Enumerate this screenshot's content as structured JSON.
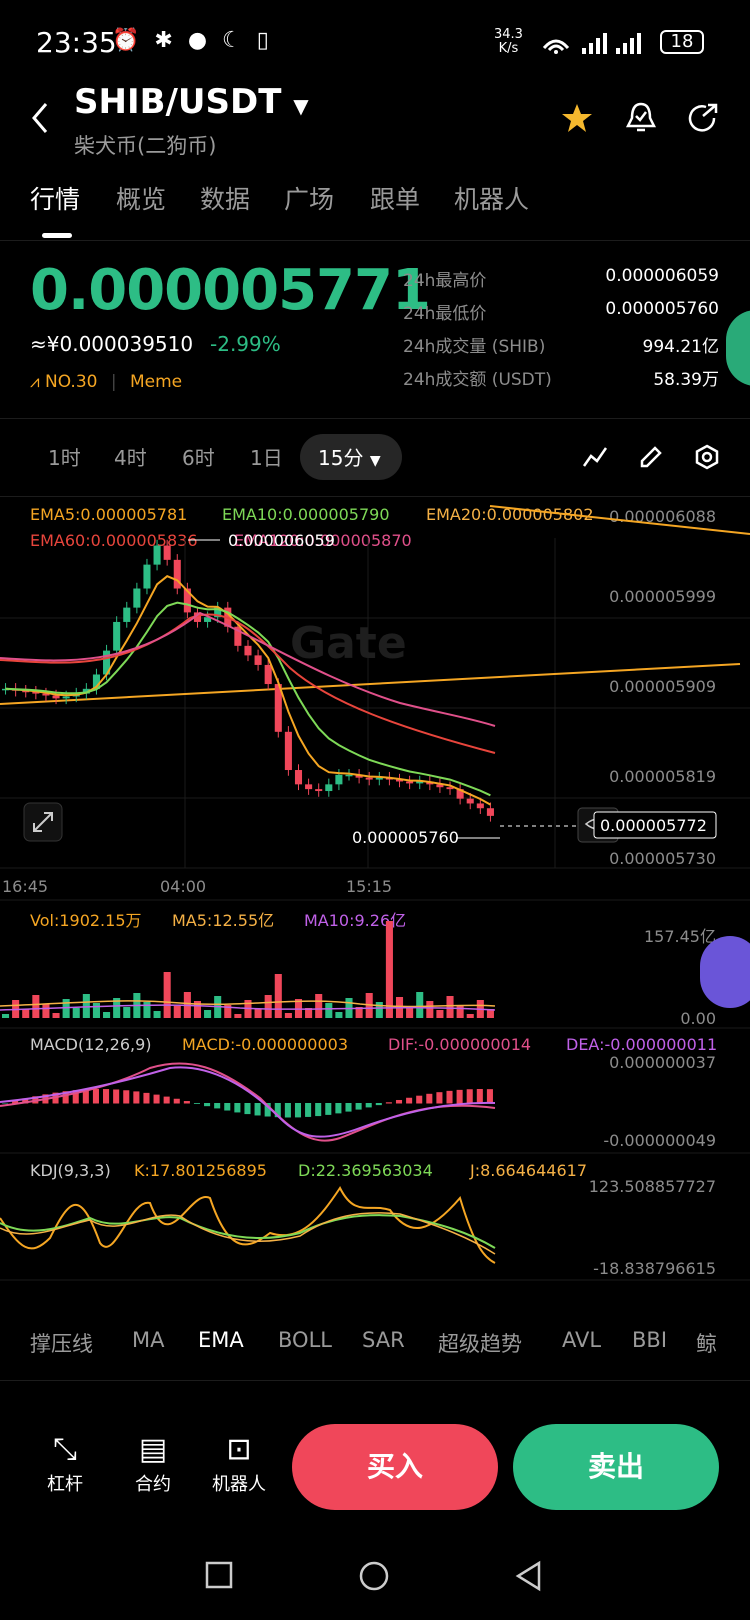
{
  "status_bar": {
    "time": "23:35",
    "net_speed_value": "34.3",
    "net_speed_unit": "K/s",
    "battery": "18"
  },
  "header": {
    "pair": "SHIB/USDT",
    "subtitle": "柴犬币(二狗币)"
  },
  "tabs": [
    "行情",
    "概览",
    "数据",
    "广场",
    "跟单",
    "机器人"
  ],
  "ticker": {
    "price": "0.000005771",
    "cny_price": "≈¥0.000039510",
    "change": "-2.99%",
    "rank": "NO.30",
    "tag": "Meme",
    "stats": [
      {
        "label": "24h最高价",
        "value": "0.000006059"
      },
      {
        "label": "24h最低价",
        "value": "0.000005760"
      },
      {
        "label": "24h成交量 (SHIB)",
        "value": "994.21亿"
      },
      {
        "label": "24h成交额 (USDT)",
        "value": "58.39万"
      }
    ]
  },
  "intervals": [
    "1时",
    "4时",
    "6时",
    "1日",
    "15分"
  ],
  "ema_legend": {
    "ema5": "EMA5:0.000005781",
    "ema10": "EMA10:0.000005790",
    "ema20": "EMA20:0.000005802",
    "ema60": "EMA60:0.000005836",
    "ema120": "EMA120:0.000005870"
  },
  "chart_data": [
    {
      "type": "candlestick",
      "price_axis": [
        "0.000006088",
        "0.000005999",
        "0.000005909",
        "0.000005819",
        "0.000005730"
      ],
      "time_axis": [
        "16:45",
        "04:00",
        "15:15"
      ],
      "high_marker": "0.000006059",
      "low_marker": "0.000005760",
      "current_price": "0.000005772",
      "close_series": [
        5.905,
        5.903,
        5.902,
        5.9,
        5.898,
        5.895,
        5.897,
        5.9,
        5.905,
        5.92,
        5.945,
        5.975,
        5.99,
        6.01,
        6.035,
        6.055,
        6.04,
        6.01,
        5.985,
        5.975,
        5.98,
        5.99,
        5.97,
        5.95,
        5.94,
        5.93,
        5.91,
        5.86,
        5.82,
        5.805,
        5.8,
        5.798,
        5.805,
        5.815,
        5.815,
        5.812,
        5.81,
        5.812,
        5.81,
        5.808,
        5.806,
        5.808,
        5.805,
        5.802,
        5.8,
        5.79,
        5.785,
        5.78,
        5.772
      ]
    },
    {
      "type": "bar",
      "title": "Vol",
      "legend": [
        "Vol:1902.15万",
        "MA5:12.55亿",
        "MA10:9.26亿"
      ],
      "axis": [
        "157.45亿",
        "0.00"
      ]
    },
    {
      "type": "line",
      "title": "MACD(12,26,9)",
      "legend": [
        "MACD:-0.000000003",
        "DIF:-0.000000014",
        "DEA:-0.000000011"
      ],
      "axis": [
        "0.000000037",
        "-0.000000049"
      ]
    },
    {
      "type": "line",
      "title": "KDJ(9,3,3)",
      "legend": [
        "K:17.801256895",
        "D:22.369563034",
        "J:8.664644617"
      ],
      "axis": [
        "123.508857727",
        "-18.838796615"
      ]
    }
  ],
  "indicator_tabs": [
    "撑压线",
    "MA",
    "EMA",
    "BOLL",
    "SAR",
    "超级趋势",
    "AVL",
    "BBI",
    "鲸"
  ],
  "bottom_actions": [
    {
      "label": "杠杆",
      "icon": "leverage-icon"
    },
    {
      "label": "合约",
      "icon": "contract-icon"
    },
    {
      "label": "机器人",
      "icon": "robot-icon"
    }
  ],
  "buy_label": "买入",
  "sell_label": "卖出",
  "colors": {
    "green": "#2dbd85",
    "red": "#f0475a",
    "ema5": "#f5a623",
    "ema10": "#7ed957",
    "ema20": "#f5b146",
    "ema60": "#e8453c",
    "ema120": "#e0508a"
  }
}
